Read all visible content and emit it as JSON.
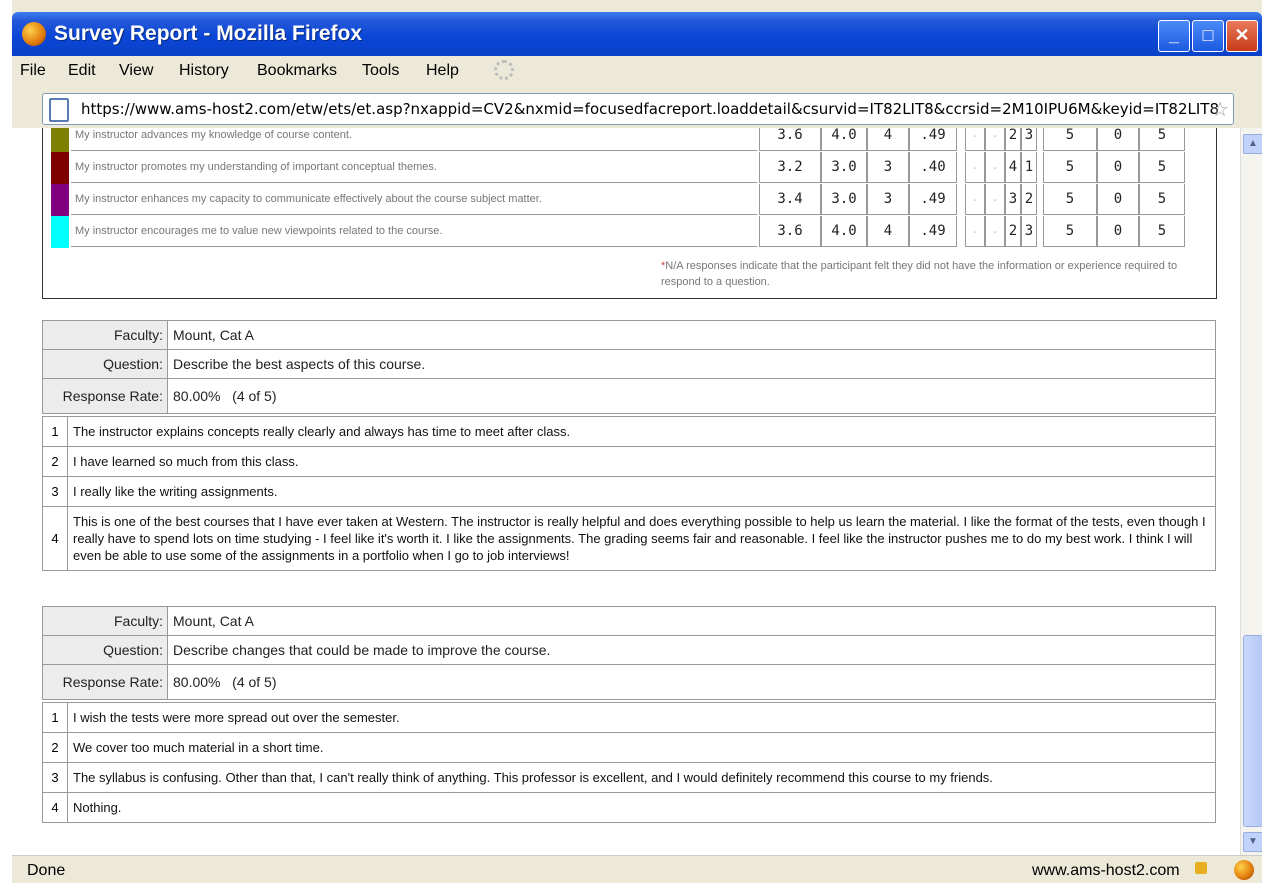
{
  "window": {
    "title": "Survey Report - Mozilla Firefox",
    "controls": [
      "_",
      "□",
      "✕"
    ]
  },
  "menu": [
    "File",
    "Edit",
    "View",
    "History",
    "Bookmarks",
    "Tools",
    "Help"
  ],
  "url": "https://www.ams-host2.com/etw/ets/et.asp?nxappid=CV2&nxmid=focusedfacreport.loaddetail&csurvid=IT82LIT8&ccrsid=2M10IPU6M&keyid=IT82LIT8",
  "status": {
    "text": "Done",
    "host": "www.ams-host2.com"
  },
  "ratings": [
    {
      "color": "#808000",
      "question": "My instructor advances my knowledge of course content.",
      "mean": "3.6",
      "median": "4.0",
      "mode": "4",
      "sd": ".49",
      "d1": "-",
      "d2": "-",
      "n4": "2",
      "n5": "3",
      "resp": "5",
      "na": "0",
      "total": "5"
    },
    {
      "color": "#800000",
      "question": "My instructor promotes my understanding of important conceptual themes.",
      "mean": "3.2",
      "median": "3.0",
      "mode": "3",
      "sd": ".40",
      "d1": "-",
      "d2": "-",
      "n4": "4",
      "n5": "1",
      "resp": "5",
      "na": "0",
      "total": "5"
    },
    {
      "color": "#800080",
      "question": "My instructor enhances my capacity to communicate effectively about the course subject matter.",
      "mean": "3.4",
      "median": "3.0",
      "mode": "3",
      "sd": ".49",
      "d1": "-",
      "d2": "-",
      "n4": "3",
      "n5": "2",
      "resp": "5",
      "na": "0",
      "total": "5"
    },
    {
      "color": "#00ffff",
      "question": "My instructor encourages me to value new viewpoints related to the course.",
      "mean": "3.6",
      "median": "4.0",
      "mode": "4",
      "sd": ".49",
      "d1": "-",
      "d2": "-",
      "n4": "2",
      "n5": "3",
      "resp": "5",
      "na": "0",
      "total": "5"
    }
  ],
  "note": {
    "asterisk": "*",
    "text": "N/A responses indicate that the participant felt they did not have the information or experience required to respond to a question."
  },
  "blocks": [
    {
      "faculty_label": "Faculty:",
      "faculty": "Mount, Cat A",
      "question_label": "Question:",
      "question": "Describe the best aspects of this course.",
      "rate_label": "Response Rate:",
      "rate": "80.00%",
      "rate_count": "(4 of 5)",
      "answers": [
        {
          "n": "1",
          "text": "The instructor explains concepts really clearly and always has time to meet after class."
        },
        {
          "n": "2",
          "text": "I have learned so much from this class."
        },
        {
          "n": "3",
          "text": "I really like the writing assignments."
        },
        {
          "n": "4",
          "text": "This is one of the best courses that I have ever taken at Western. The instructor is really helpful and does everything possible to help us learn the material. I like the format of the tests, even though I really have to spend lots on time studying - I feel like it's worth it. I like the assignments. The grading seems fair and reasonable. I feel like the instructor pushes me to do my best work. I think I will even be able to use some of the assignments in a portfolio when I go to job interviews!"
        }
      ]
    },
    {
      "faculty_label": "Faculty:",
      "faculty": "Mount, Cat A",
      "question_label": "Question:",
      "question": "Describe changes that could be made to improve the course.",
      "rate_label": "Response Rate:",
      "rate": "80.00%",
      "rate_count": "(4 of 5)",
      "answers": [
        {
          "n": "1",
          "text": "I wish the tests were more spread out over the semester."
        },
        {
          "n": "2",
          "text": "We cover too much material in a short time."
        },
        {
          "n": "3",
          "text": "The syllabus is confusing. Other than that, I can't really think of anything. This professor is excellent, and I would definitely recommend this course to my friends."
        },
        {
          "n": "4",
          "text": "Nothing."
        }
      ]
    }
  ]
}
